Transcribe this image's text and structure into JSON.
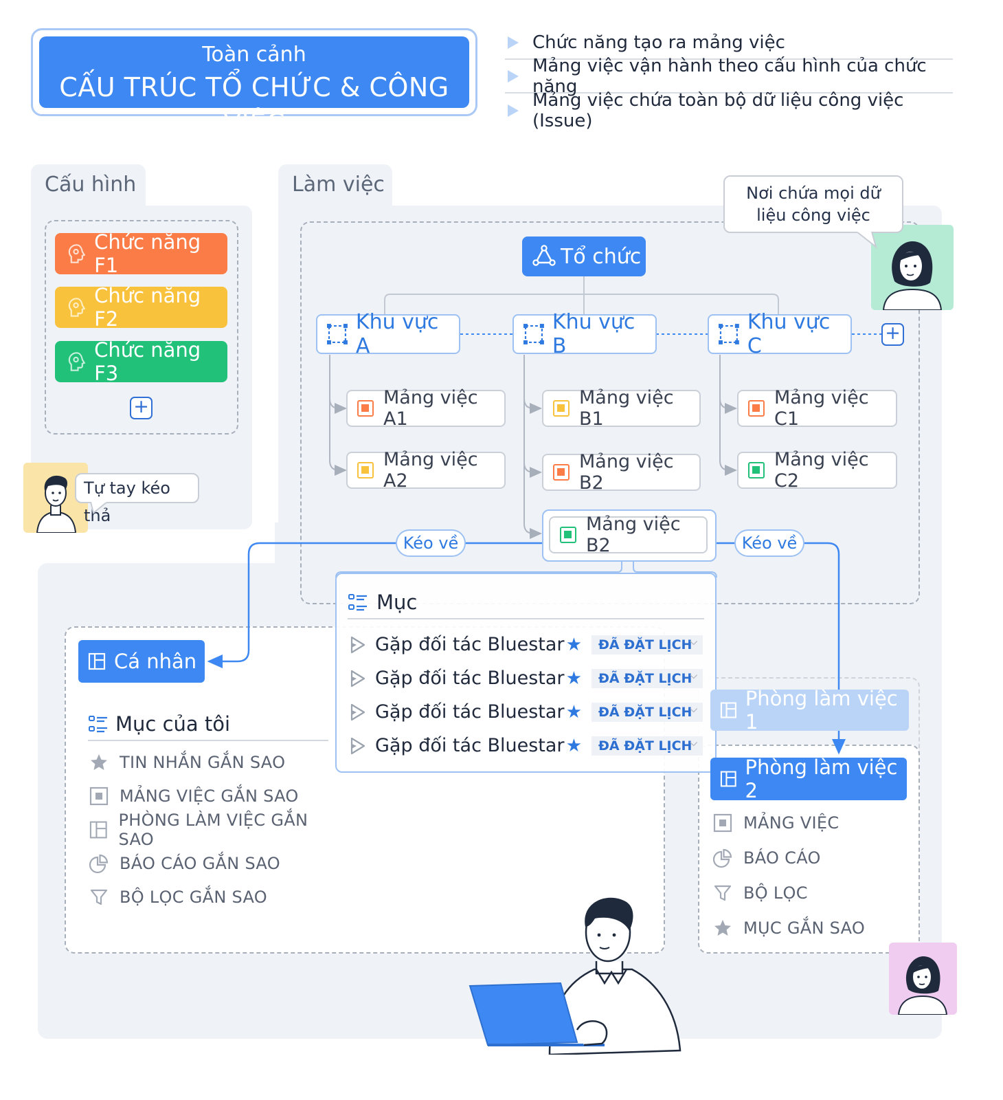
{
  "header": {
    "subtitle": "Toàn cảnh",
    "title": "CẤU TRÚC TỔ CHỨC & CÔNG VIỆC",
    "bullets": [
      "Chức năng tạo ra mảng việc",
      "Mảng việc vận hành theo cấu hình của chức năng",
      "Mảng việc chứa toàn bộ dữ liệu công việc (Issue)"
    ]
  },
  "config_panel": {
    "label": "Cấu hình",
    "functions": [
      "Chức năng F1",
      "Chức năng F2",
      "Chức năng F3"
    ],
    "function_colors": [
      "#fb7c47",
      "#f9c23c",
      "#22c17a"
    ],
    "add_symbol": "+",
    "speech": "Tự tay kéo thả"
  },
  "work_panel": {
    "label": "Làm việc",
    "speech": "Nơi chứa mọi dữ liệu công việc",
    "org": "Tổ chức",
    "areas": [
      "Khu vực A",
      "Khu vực B",
      "Khu vực C"
    ],
    "add_symbol": "+",
    "workstreams": {
      "a1": "Mảng việc A1",
      "a2": "Mảng việc A2",
      "b1": "Mảng việc B1",
      "b2": "Mảng việc B2",
      "b2_selected": "Mảng việc B2",
      "c1": "Mảng việc C1",
      "c2": "Mảng việc C2"
    },
    "drag_labels": [
      "Kéo về",
      "Kéo về"
    ]
  },
  "items_popup": {
    "title": "Mục",
    "rows": [
      {
        "name": "Gặp đối tác Bluestar",
        "status": "ĐÃ ĐẶT LỊCH"
      },
      {
        "name": "Gặp đối tác Bluestar",
        "status": "ĐÃ ĐẶT LỊCH"
      },
      {
        "name": "Gặp đối tác Bluestar",
        "status": "ĐÃ ĐẶT LỊCH"
      },
      {
        "name": "Gặp đối tác Bluestar",
        "status": "ĐÃ ĐẶT LỊCH"
      }
    ],
    "star_symbol": "★"
  },
  "personal": {
    "button": "Cá nhân",
    "section": "Mục của tôi",
    "items": [
      {
        "label": "TIN NHẮN GẮN SAO",
        "icon": "star-icon"
      },
      {
        "label": "MẢNG VIỆC GẮN SAO",
        "icon": "square-icon"
      },
      {
        "label": "PHÒNG LÀM VIỆC GẮN SAO",
        "icon": "layout-icon"
      },
      {
        "label": "BÁO CÁO GẮN SAO",
        "icon": "pie-chart-icon"
      },
      {
        "label": "BỘ LỌC GẮN SAO",
        "icon": "filter-icon"
      }
    ]
  },
  "workrooms": {
    "room1": "Phòng làm việc 1",
    "room2": "Phòng làm việc 2",
    "items": [
      {
        "label": "MẢNG VIỆC",
        "icon": "square-icon"
      },
      {
        "label": "BÁO CÁO",
        "icon": "pie-chart-icon"
      },
      {
        "label": "BỘ LỌC",
        "icon": "filter-icon"
      },
      {
        "label": "MỤC GẮN SAO",
        "icon": "star-icon"
      }
    ]
  },
  "colors": {
    "primary": "#3d88f2",
    "primary_pale": "#b9d4f7",
    "panel_bg": "#eff2f6",
    "orange": "#fb7c47",
    "yellow": "#f9c23c",
    "green": "#22c17a"
  }
}
